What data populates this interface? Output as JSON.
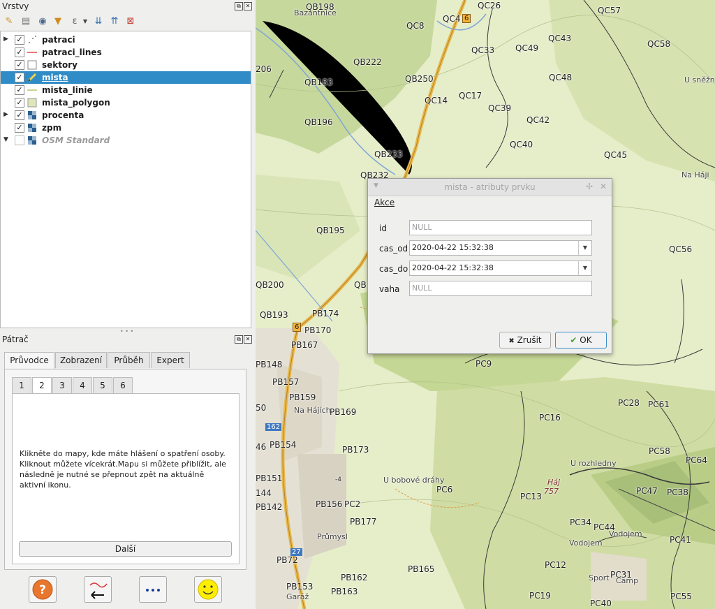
{
  "layers_panel": {
    "title": "Vrstvy"
  },
  "layers": [
    {
      "label": "patraci",
      "checked": true,
      "expander": "▶",
      "icon": "points-icon"
    },
    {
      "label": "patraci_lines",
      "checked": true,
      "expander": "",
      "icon": "red-line-icon"
    },
    {
      "label": "sektory",
      "checked": true,
      "expander": "",
      "icon": "polygon-empty-icon"
    },
    {
      "label": "mista",
      "checked": true,
      "expander": "",
      "icon": "edit-pencil-icon",
      "selected": true
    },
    {
      "label": "mista_linie",
      "checked": true,
      "expander": "",
      "icon": "line-icon"
    },
    {
      "label": "mista_polygon",
      "checked": true,
      "expander": "",
      "icon": "polygon-green-icon"
    },
    {
      "label": "procenta",
      "checked": true,
      "expander": "▶",
      "icon": "raster-icon"
    },
    {
      "label": "zpm",
      "checked": true,
      "expander": "",
      "icon": "raster-icon"
    },
    {
      "label": "OSM Standard",
      "checked": false,
      "expander": "▼",
      "icon": "raster-icon"
    }
  ],
  "patrac_panel": {
    "title": "Pátrač"
  },
  "tabs": [
    "Průvodce",
    "Zobrazení",
    "Průběh",
    "Expert"
  ],
  "subtabs": [
    "1",
    "2",
    "3",
    "4",
    "5",
    "6"
  ],
  "instructions": "Klikněte do mapy, kde máte hlášení o spatření osoby. Kliknout můžete vícekrát.Mapu si můžete přiblížit, ale následně je nutné se přepnout zpět na aktuálně aktivní ikonu.",
  "next_button": "Další",
  "map_labels": [
    {
      "t": "QB198"
    },
    {
      "t": "Bazantnice"
    },
    {
      "t": "QC4"
    },
    {
      "t": "QC26"
    },
    {
      "t": "QC57"
    },
    {
      "t": "QC8"
    },
    {
      "t": "QC43"
    },
    {
      "t": "QC58"
    },
    {
      "t": "QC33"
    },
    {
      "t": "QC49"
    },
    {
      "t": "QB222"
    },
    {
      "t": "206"
    },
    {
      "t": "QB250"
    },
    {
      "t": "QC48"
    },
    {
      "t": "U sněžn"
    },
    {
      "t": "QB183"
    },
    {
      "t": "QC17"
    },
    {
      "t": "QC14"
    },
    {
      "t": "QC39"
    },
    {
      "t": "QC42"
    },
    {
      "t": "QB196"
    },
    {
      "t": "QC40"
    },
    {
      "t": "QB233"
    },
    {
      "t": "QC45"
    },
    {
      "t": "QB232"
    },
    {
      "t": "Na Háji"
    },
    {
      "t": "QB195"
    },
    {
      "t": "QC56"
    },
    {
      "t": "QB200"
    },
    {
      "t": "QB"
    },
    {
      "t": "QB193"
    },
    {
      "t": "PB174"
    },
    {
      "t": "PB170"
    },
    {
      "t": "PB167"
    },
    {
      "t": "PB148"
    },
    {
      "t": "PC9"
    },
    {
      "t": "PB157"
    },
    {
      "t": "PB159"
    },
    {
      "t": "Na Hájích"
    },
    {
      "t": "PB169"
    },
    {
      "t": "PC28"
    },
    {
      "t": "PC61"
    },
    {
      "t": "50"
    },
    {
      "t": "PC16"
    },
    {
      "t": "46"
    },
    {
      "t": "PB154"
    },
    {
      "t": "PB173"
    },
    {
      "t": "PC58"
    },
    {
      "t": "PC64"
    },
    {
      "t": "U rozhledny"
    },
    {
      "t": "PB151"
    },
    {
      "t": "U bobové dráhy"
    },
    {
      "t": "PC6"
    },
    {
      "t": "Háj"
    },
    {
      "t": "757"
    },
    {
      "t": "PC47"
    },
    {
      "t": "PC38"
    },
    {
      "t": "144"
    },
    {
      "t": "PB156"
    },
    {
      "t": "PC2"
    },
    {
      "t": "PC13"
    },
    {
      "t": "PB142"
    },
    {
      "t": "PB177"
    },
    {
      "t": "PC34"
    },
    {
      "t": "PC44"
    },
    {
      "t": "Průmysl"
    },
    {
      "t": "Vodojem"
    },
    {
      "t": "Vodojem"
    },
    {
      "t": "PC41"
    },
    {
      "t": "PB72"
    },
    {
      "t": "PB165"
    },
    {
      "t": "PC12"
    },
    {
      "t": "PB162"
    },
    {
      "t": "Sport"
    },
    {
      "t": "PC31"
    },
    {
      "t": "Camp"
    },
    {
      "t": "PB153"
    },
    {
      "t": "Garáž"
    },
    {
      "t": "PB163"
    },
    {
      "t": "PC19"
    },
    {
      "t": "PC40"
    },
    {
      "t": "PC55"
    },
    {
      "t": "6"
    },
    {
      "t": "6"
    },
    {
      "t": "162"
    },
    {
      "t": "27"
    },
    {
      "t": "-4"
    }
  ],
  "dialog": {
    "title": "mista - atributy prvku",
    "menu": "Akce",
    "fields": [
      {
        "label": "id",
        "value": "",
        "placeholder": "NULL",
        "dropdown": false
      },
      {
        "label": "cas_od",
        "value": "2020-04-22 15:32:38",
        "placeholder": "",
        "dropdown": true
      },
      {
        "label": "cas_do",
        "value": "2020-04-22 15:32:38",
        "placeholder": "",
        "dropdown": true
      },
      {
        "label": "vaha",
        "value": "",
        "placeholder": "NULL",
        "dropdown": false
      }
    ],
    "cancel": "Zrušit",
    "ok": "OK"
  }
}
